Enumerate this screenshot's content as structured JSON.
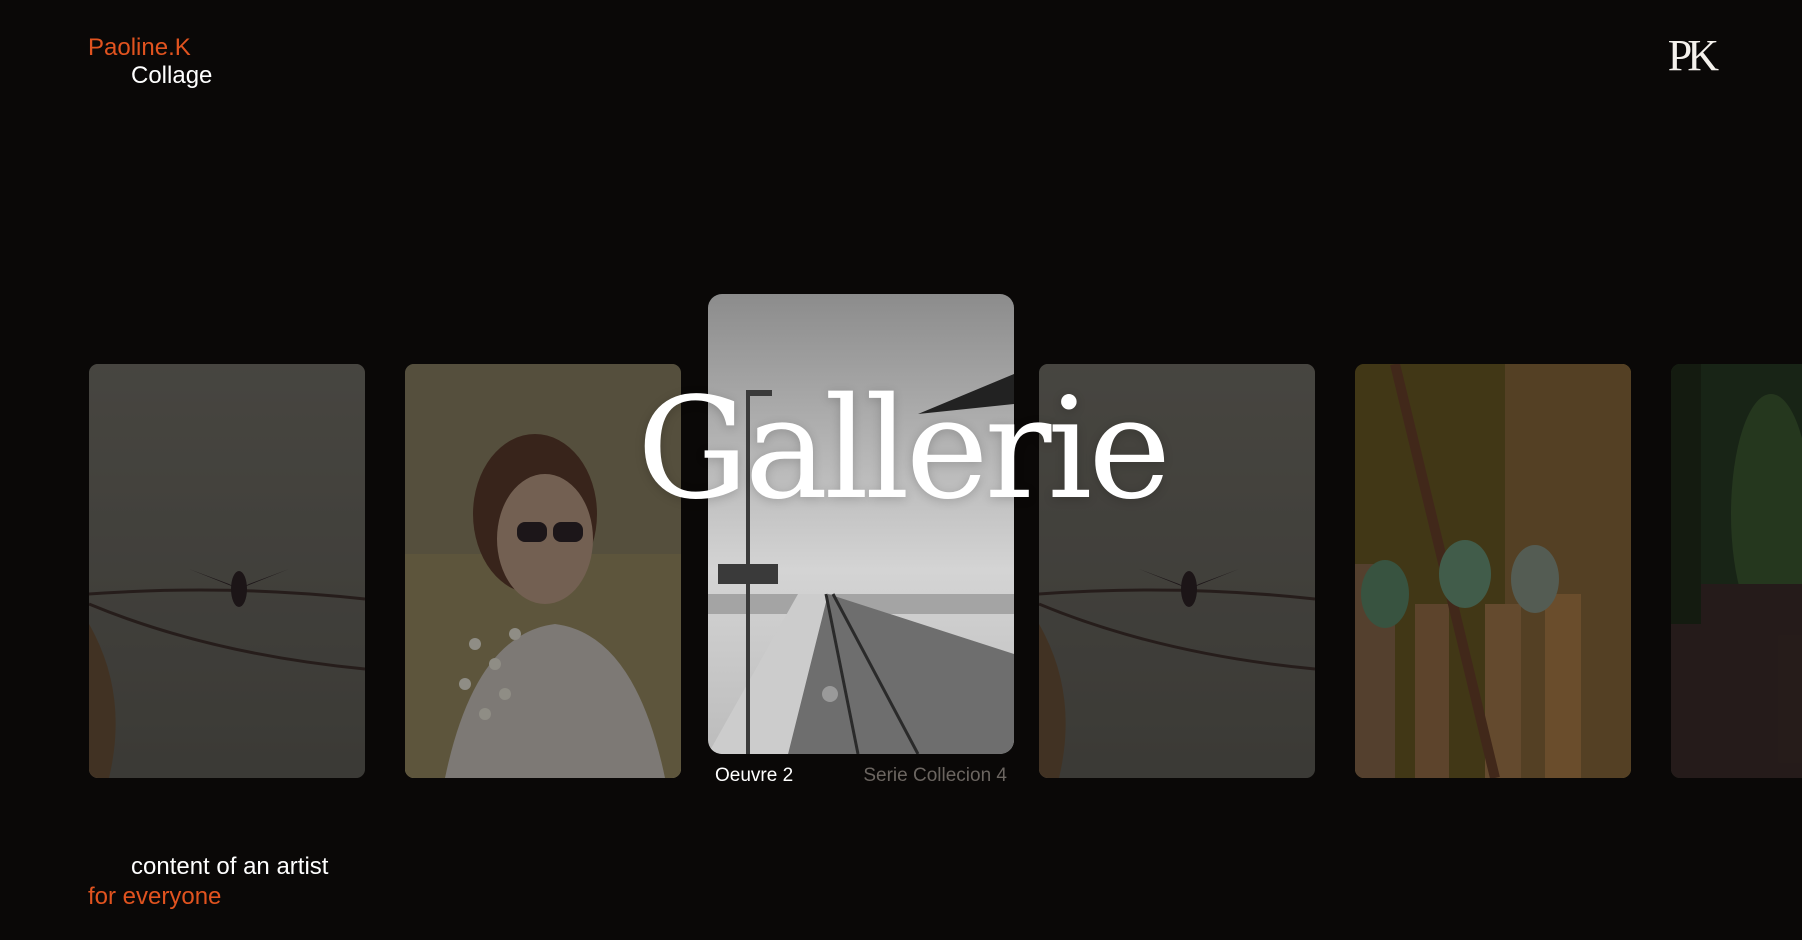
{
  "brand": {
    "name": "Paoline.K",
    "subtitle": "Collage",
    "monogram": "PK"
  },
  "tagline": {
    "line1": "content of an artist",
    "line2": "for everyone"
  },
  "heading": "Gallerie",
  "active_card": {
    "title": "Oeuvre 2",
    "series": "Serie Collecion 4"
  },
  "cards": [
    {
      "subject": "cormorant-on-boat"
    },
    {
      "subject": "girl-with-flowers"
    },
    {
      "subject": "pier-black-and-white"
    },
    {
      "subject": "cormorant-on-boat"
    },
    {
      "subject": "green-bottles-on-sticks"
    },
    {
      "subject": "forest-path"
    }
  ],
  "colors": {
    "accent": "#e1531f",
    "background": "#0a0807",
    "text": "#ffffff",
    "muted": "#6b6560"
  }
}
